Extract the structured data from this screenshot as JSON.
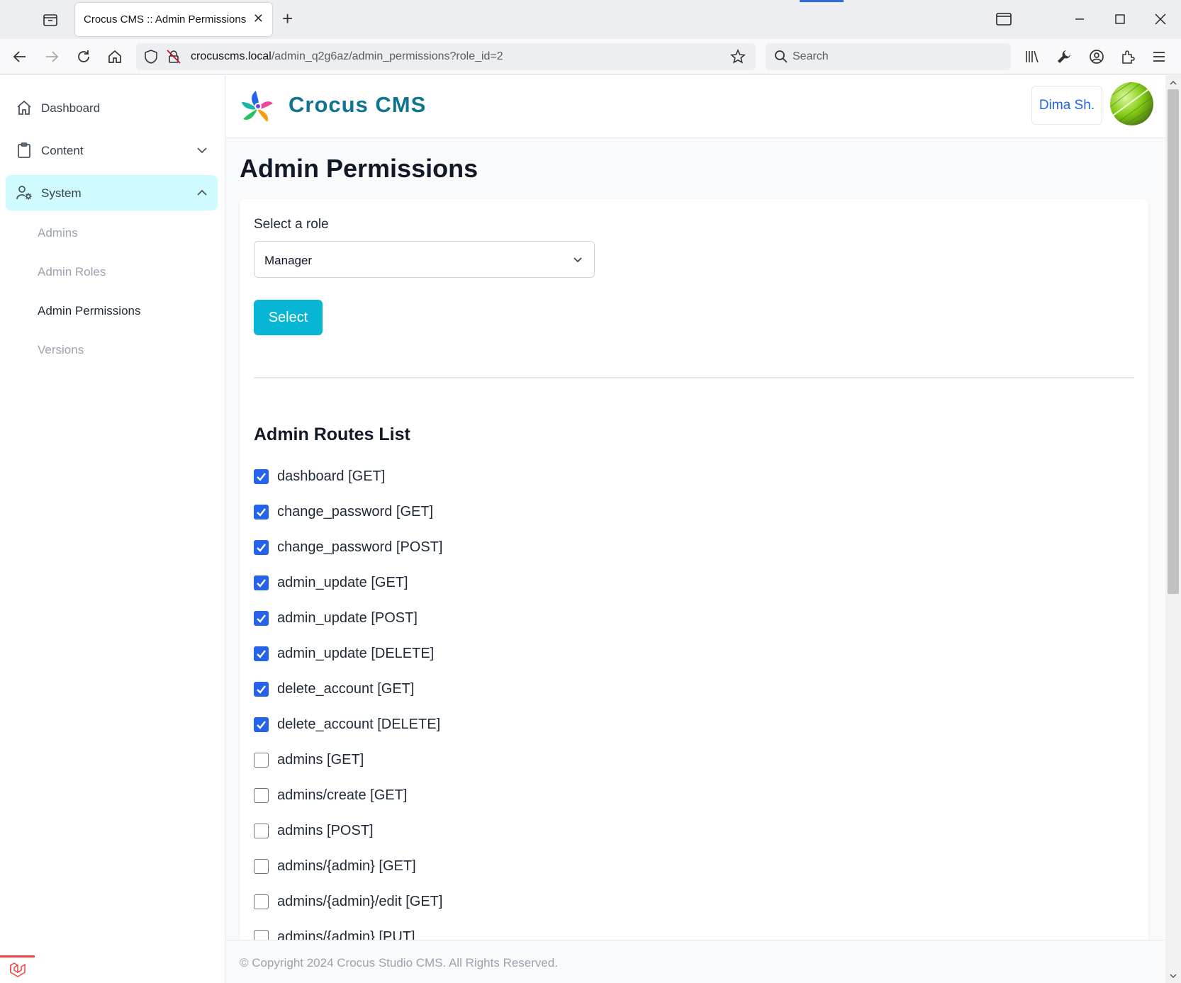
{
  "browser": {
    "tab_title": "Crocus CMS :: Admin Permissions",
    "url_host": "crocuscms.local",
    "url_path": "/admin_q2g6az/admin_permissions?role_id=2",
    "search_placeholder": "Search"
  },
  "sidebar": {
    "items": [
      {
        "label": "Dashboard",
        "icon": "home-icon"
      },
      {
        "label": "Content",
        "icon": "clipboard-icon"
      },
      {
        "label": "System",
        "icon": "user-cog-icon"
      }
    ],
    "sub_items": [
      "Admins",
      "Admin Roles",
      "Admin Permissions",
      "Versions"
    ]
  },
  "header": {
    "brand": "Crocus CMS",
    "user_name": "Dima Sh."
  },
  "main": {
    "page_title": "Admin Permissions",
    "role_label": "Select a role",
    "role_selected": "Manager",
    "select_button": "Select",
    "routes_title": "Admin Routes List",
    "routes": [
      {
        "label": "dashboard [GET]",
        "checked": true
      },
      {
        "label": "change_password [GET]",
        "checked": true
      },
      {
        "label": "change_password [POST]",
        "checked": true
      },
      {
        "label": "admin_update [GET]",
        "checked": true
      },
      {
        "label": "admin_update [POST]",
        "checked": true
      },
      {
        "label": "admin_update [DELETE]",
        "checked": true
      },
      {
        "label": "delete_account [GET]",
        "checked": true
      },
      {
        "label": "delete_account [DELETE]",
        "checked": true
      },
      {
        "label": "admins [GET]",
        "checked": false
      },
      {
        "label": "admins/create [GET]",
        "checked": false
      },
      {
        "label": "admins [POST]",
        "checked": false
      },
      {
        "label": "admins/{admin} [GET]",
        "checked": false
      },
      {
        "label": "admins/{admin}/edit [GET]",
        "checked": false
      },
      {
        "label": "admins/{admin} [PUT]",
        "checked": false
      }
    ]
  },
  "footer": {
    "text": "© Copyright 2024 Crocus Studio CMS. All Rights Reserved."
  },
  "colors": {
    "accent": "#06b6d4",
    "brand": "#0e7490",
    "checkbox": "#2563eb",
    "active_nav": "#cffafe"
  }
}
